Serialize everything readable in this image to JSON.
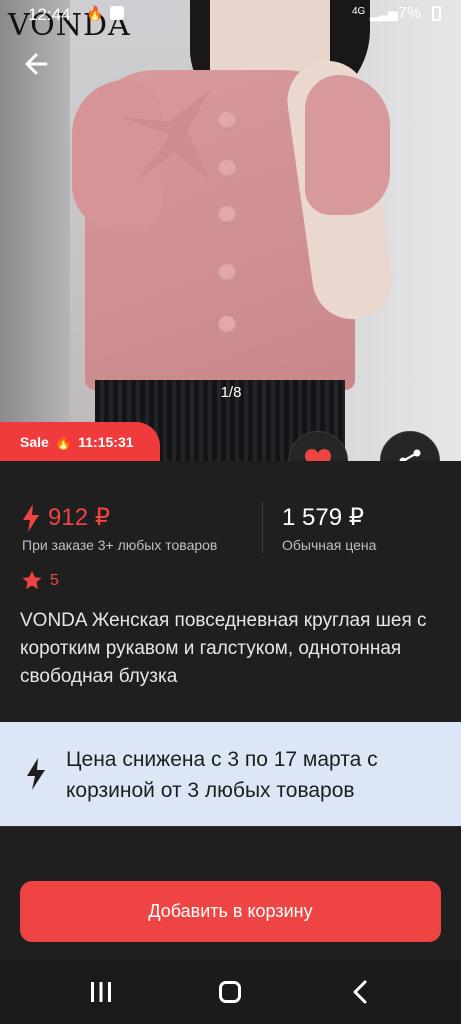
{
  "status_bar": {
    "time": "12:44",
    "network": "4G",
    "battery": "7%"
  },
  "hero": {
    "brand_logo": "VONDA",
    "page_indicator": "1/8"
  },
  "sale_badge": {
    "label": "Sale",
    "emoji": "🔥",
    "timer": "11:15:31"
  },
  "prices": {
    "promo_price": "912 ₽",
    "promo_condition": "При заказе 3+ любых товаров",
    "regular_price": "1 579 ₽",
    "regular_label": "Обычная цена"
  },
  "rating": {
    "value": "5"
  },
  "product": {
    "title": "VONDA Женская повседневная круглая шея с коротким рукавом и галстуком, однотонная свободная блузка"
  },
  "promo_banner": {
    "text": "Цена снижена с 3 по 17 марта с корзиной от 3 любых товаров"
  },
  "cta": {
    "add_to_cart": "Добавить в корзину"
  },
  "colors": {
    "accent": "#ef4444",
    "background": "#1f1f1f",
    "banner": "#dde6f6"
  },
  "icons": [
    "back-arrow-icon",
    "heart-icon",
    "share-icon",
    "lightning-icon",
    "star-icon",
    "recent-apps-icon",
    "home-icon",
    "nav-back-icon"
  ]
}
